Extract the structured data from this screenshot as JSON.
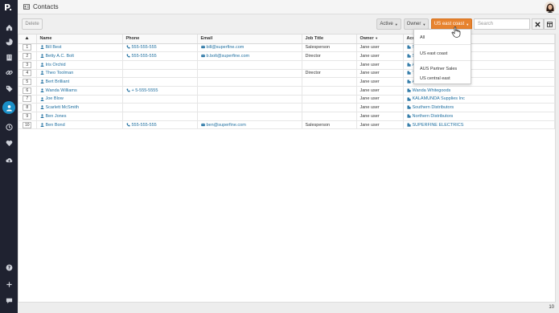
{
  "app": {
    "logo": "P.",
    "page_title": "Contacts"
  },
  "toolbar": {
    "delete_label": "Delete",
    "active_label": "Active",
    "owner_label": "Owner",
    "region_label": "US east coast",
    "search_placeholder": "Search"
  },
  "columns": [
    "",
    "Name",
    "Phone",
    "Email",
    "Job Title",
    "Owner",
    "Acc"
  ],
  "rows": [
    {
      "n": "1",
      "name": "Bill Best",
      "phone": "555-555-555",
      "email": "bill@superfine.com",
      "job": "Salesperson",
      "owner": "Jane user",
      "account": "S"
    },
    {
      "n": "2",
      "name": "Betty A.C. Bolt",
      "phone": "555-555-555",
      "email": "b.bolt@superfine.com",
      "job": "Director",
      "owner": "Jane user",
      "account": "S"
    },
    {
      "n": "3",
      "name": "Iris Orchid",
      "phone": "",
      "email": "",
      "job": "",
      "owner": "Jane user",
      "account": "A ...RS"
    },
    {
      "n": "4",
      "name": "Theo Toolman",
      "phone": "",
      "email": "",
      "job": "Director",
      "owner": "Jane user",
      "account": "T"
    },
    {
      "n": "5",
      "name": "Bert Brilliant",
      "phone": "",
      "email": "",
      "job": "",
      "owner": "Jane user",
      "account": "A"
    },
    {
      "n": "6",
      "name": "Wanda Williams",
      "phone": "+ 5-555-5555",
      "email": "",
      "job": "",
      "owner": "Jane user",
      "account": "Wanda Whitegoods"
    },
    {
      "n": "7",
      "name": "Joe Blow",
      "phone": "",
      "email": "",
      "job": "",
      "owner": "Jane user",
      "account": "KALAMUNDA Supplies Inc"
    },
    {
      "n": "8",
      "name": "Scarlett McSmith",
      "phone": "",
      "email": "",
      "job": "",
      "owner": "Jane user",
      "account": "Southern Distributors"
    },
    {
      "n": "9",
      "name": "Ben Jones",
      "phone": "",
      "email": "",
      "job": "",
      "owner": "Jane user",
      "account": "Northern Distributors"
    },
    {
      "n": "10",
      "name": "Ben Bond",
      "phone": "555-555-555",
      "email": "ben@superfine.com",
      "job": "Salesperson",
      "owner": "Jane user",
      "account": "SUPERFINE ELECTRICS"
    }
  ],
  "dropdown": {
    "items": [
      "All",
      "US east coast",
      "AUS Partner Sales",
      "US central east"
    ]
  },
  "footer": {
    "count": "10"
  },
  "colors": {
    "accent": "#e7832f",
    "link": "#1f6fa0",
    "sidebar": "#1f2230",
    "active_nav": "#1a8fc7"
  }
}
